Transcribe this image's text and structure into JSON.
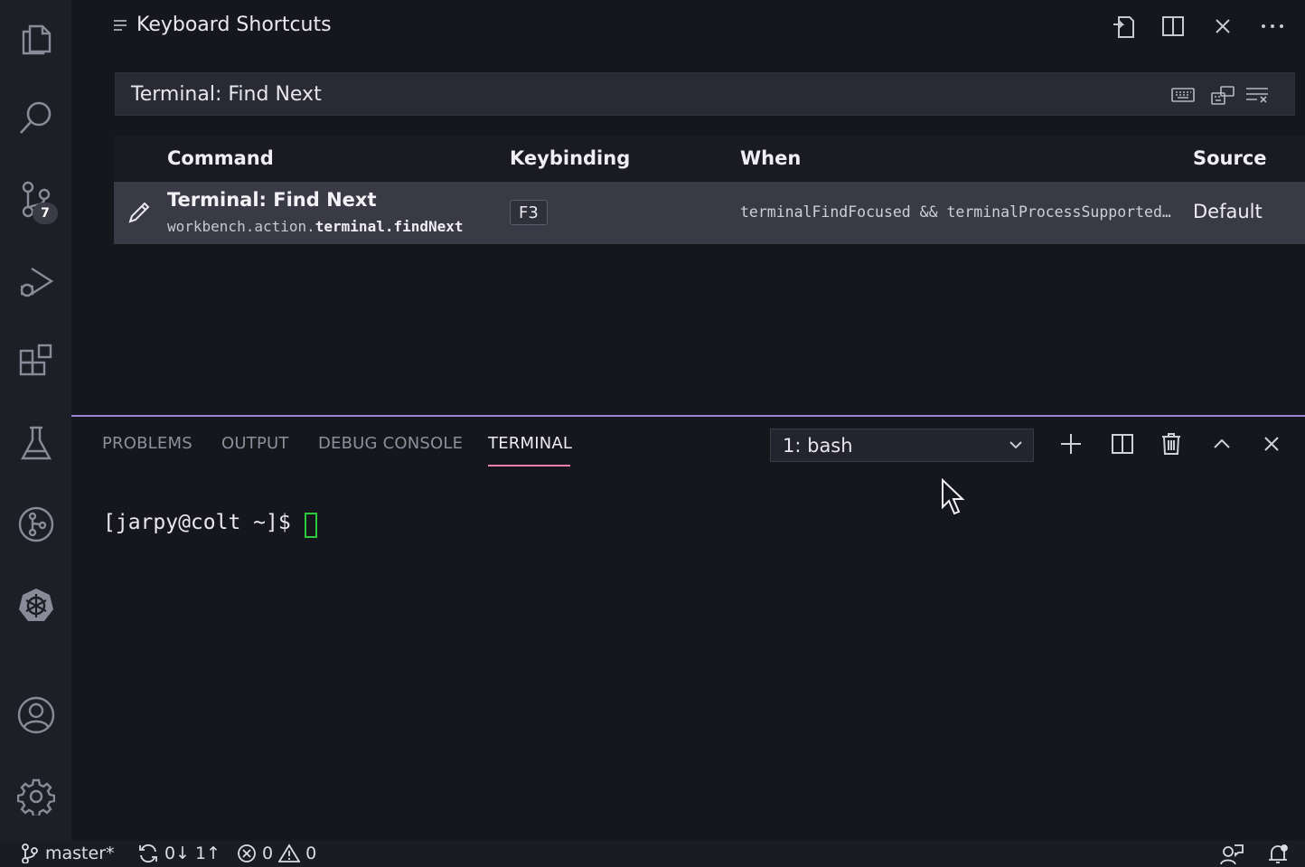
{
  "editor": {
    "tab_title": "Keyboard Shortcuts",
    "search_value": "Terminal: Find Next",
    "columns": {
      "command": "Command",
      "keybinding": "Keybinding",
      "when": "When",
      "source": "Source"
    },
    "rows": [
      {
        "title": "Terminal: Find Next",
        "command_id_prefix": "workbench.action.",
        "command_id_bold": "terminal.findNext",
        "keybinding": "F3",
        "when": "terminalFindFocused && terminalProcessSupported…",
        "source": "Default"
      }
    ]
  },
  "activity_bar": {
    "source_control_badge": "7",
    "items": [
      "explorer",
      "search",
      "source-control",
      "run-debug",
      "extensions",
      "testing",
      "git-graph",
      "kubernetes",
      "accounts",
      "manage"
    ]
  },
  "panel": {
    "tabs": [
      "PROBLEMS",
      "OUTPUT",
      "DEBUG CONSOLE",
      "TERMINAL"
    ],
    "active_tab": "TERMINAL",
    "terminal_selector": "1: bash",
    "prompt": "[jarpy@colt ~]$ "
  },
  "status_bar": {
    "branch": "master*",
    "sync": "0↓ 1↑",
    "errors": "0",
    "warnings": "0"
  },
  "colors": {
    "accent_underline": "#ee7fa8",
    "panel_border": "#9a86d6",
    "cursor": "#2ec93a"
  }
}
